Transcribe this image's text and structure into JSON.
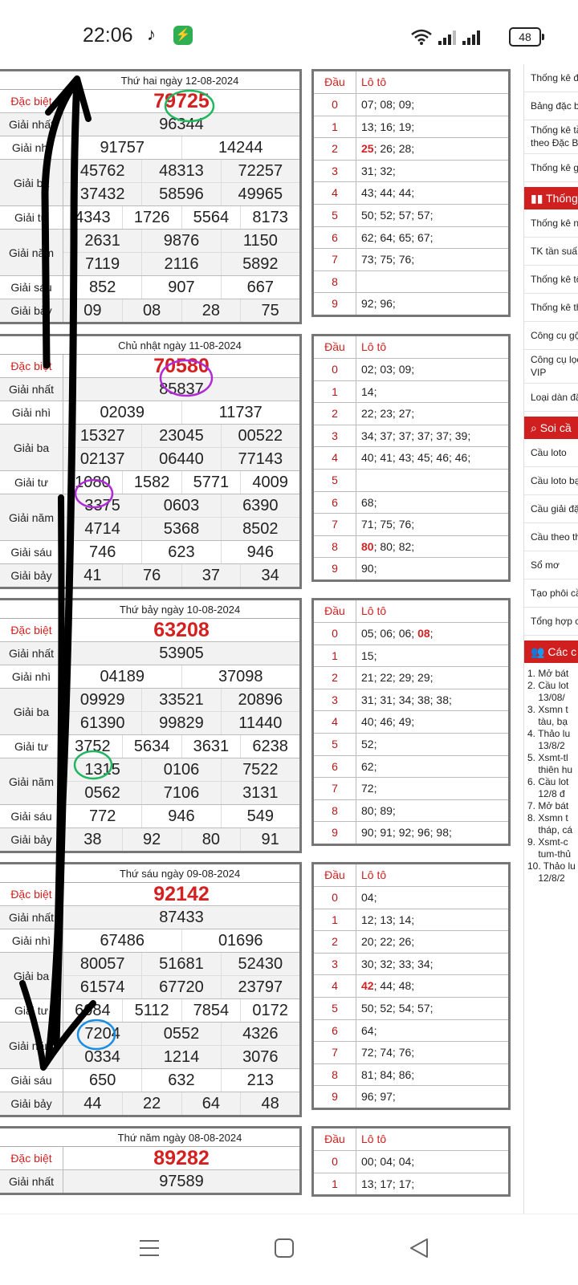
{
  "status_bar": {
    "time": "22:06",
    "battery": "48"
  },
  "draws": [
    {
      "header": "Thứ hai ngày 12-08-2024",
      "prizes": [
        {
          "label": "Đặc biệt",
          "rows": [
            [
              "79725"
            ]
          ],
          "special": true
        },
        {
          "label": "Giải nhất",
          "rows": [
            [
              "96344"
            ]
          ]
        },
        {
          "label": "Giải nhì",
          "rows": [
            [
              "91757",
              "14244"
            ]
          ]
        },
        {
          "label": "Giải ba",
          "rows": [
            [
              "45762",
              "48313",
              "72257"
            ],
            [
              "37432",
              "58596",
              "49965"
            ]
          ]
        },
        {
          "label": "Giải tư",
          "rows": [
            [
              "4343",
              "1726",
              "5564",
              "8173"
            ]
          ]
        },
        {
          "label": "Giải năm",
          "rows": [
            [
              "2631",
              "9876",
              "1150"
            ],
            [
              "7119",
              "2116",
              "5892"
            ]
          ]
        },
        {
          "label": "Giải sáu",
          "rows": [
            [
              "852",
              "907",
              "667"
            ]
          ]
        },
        {
          "label": "Giải bảy",
          "rows": [
            [
              "09",
              "08",
              "28",
              "75"
            ]
          ]
        }
      ],
      "loto": [
        {
          "dau": "0",
          "nums": [
            [
              "07; 08; 09;",
              false
            ]
          ]
        },
        {
          "dau": "1",
          "nums": [
            [
              "13; 16; 19;",
              false
            ]
          ]
        },
        {
          "dau": "2",
          "nums": [
            [
              "25",
              true
            ],
            [
              "; 26; 28;",
              false
            ]
          ]
        },
        {
          "dau": "3",
          "nums": [
            [
              "31; 32;",
              false
            ]
          ]
        },
        {
          "dau": "4",
          "nums": [
            [
              "43; 44; 44;",
              false
            ]
          ]
        },
        {
          "dau": "5",
          "nums": [
            [
              "50; 52; 57; 57;",
              false
            ]
          ]
        },
        {
          "dau": "6",
          "nums": [
            [
              "62; 64; 65; 67;",
              false
            ]
          ]
        },
        {
          "dau": "7",
          "nums": [
            [
              "73; 75; 76;",
              false
            ]
          ]
        },
        {
          "dau": "8",
          "nums": [
            [
              "",
              false
            ]
          ]
        },
        {
          "dau": "9",
          "nums": [
            [
              "92; 96;",
              false
            ]
          ]
        }
      ]
    },
    {
      "header": "Chủ nhật ngày 11-08-2024",
      "prizes": [
        {
          "label": "Đặc biệt",
          "rows": [
            [
              "70580"
            ]
          ],
          "special": true
        },
        {
          "label": "Giải nhất",
          "rows": [
            [
              "85837"
            ]
          ]
        },
        {
          "label": "Giải nhì",
          "rows": [
            [
              "02039",
              "11737"
            ]
          ]
        },
        {
          "label": "Giải ba",
          "rows": [
            [
              "15327",
              "23045",
              "00522"
            ],
            [
              "02137",
              "06440",
              "77143"
            ]
          ]
        },
        {
          "label": "Giải tư",
          "rows": [
            [
              "1080",
              "1582",
              "5771",
              "4009"
            ]
          ]
        },
        {
          "label": "Giải năm",
          "rows": [
            [
              "3375",
              "0603",
              "6390"
            ],
            [
              "4714",
              "5368",
              "8502"
            ]
          ]
        },
        {
          "label": "Giải sáu",
          "rows": [
            [
              "746",
              "623",
              "946"
            ]
          ]
        },
        {
          "label": "Giải bảy",
          "rows": [
            [
              "41",
              "76",
              "37",
              "34"
            ]
          ]
        }
      ],
      "loto": [
        {
          "dau": "0",
          "nums": [
            [
              "02; 03; 09;",
              false
            ]
          ]
        },
        {
          "dau": "1",
          "nums": [
            [
              "14;",
              false
            ]
          ]
        },
        {
          "dau": "2",
          "nums": [
            [
              "22; 23; 27;",
              false
            ]
          ]
        },
        {
          "dau": "3",
          "nums": [
            [
              "34; 37; 37; 37; 37; 39;",
              false
            ]
          ]
        },
        {
          "dau": "4",
          "nums": [
            [
              "40; 41; 43; 45; 46; 46;",
              false
            ]
          ]
        },
        {
          "dau": "5",
          "nums": [
            [
              "",
              false
            ]
          ]
        },
        {
          "dau": "6",
          "nums": [
            [
              "68;",
              false
            ]
          ]
        },
        {
          "dau": "7",
          "nums": [
            [
              "71; 75; 76;",
              false
            ]
          ]
        },
        {
          "dau": "8",
          "nums": [
            [
              "80",
              true
            ],
            [
              "; 80; 82;",
              false
            ]
          ]
        },
        {
          "dau": "9",
          "nums": [
            [
              "90;",
              false
            ]
          ]
        }
      ]
    },
    {
      "header": "Thứ bảy ngày 10-08-2024",
      "prizes": [
        {
          "label": "Đặc biệt",
          "rows": [
            [
              "63208"
            ]
          ],
          "special": true
        },
        {
          "label": "Giải nhất",
          "rows": [
            [
              "53905"
            ]
          ]
        },
        {
          "label": "Giải nhì",
          "rows": [
            [
              "04189",
              "37098"
            ]
          ]
        },
        {
          "label": "Giải ba",
          "rows": [
            [
              "09929",
              "33521",
              "20896"
            ],
            [
              "61390",
              "99829",
              "11440"
            ]
          ]
        },
        {
          "label": "Giải tư",
          "rows": [
            [
              "3752",
              "5634",
              "3631",
              "6238"
            ]
          ]
        },
        {
          "label": "Giải năm",
          "rows": [
            [
              "1315",
              "0106",
              "7522"
            ],
            [
              "0562",
              "7106",
              "3131"
            ]
          ]
        },
        {
          "label": "Giải sáu",
          "rows": [
            [
              "772",
              "946",
              "549"
            ]
          ]
        },
        {
          "label": "Giải bảy",
          "rows": [
            [
              "38",
              "92",
              "80",
              "91"
            ]
          ]
        }
      ],
      "loto": [
        {
          "dau": "0",
          "nums": [
            [
              "05; 06; 06; ",
              false
            ],
            [
              "08",
              true
            ],
            [
              ";",
              false
            ]
          ]
        },
        {
          "dau": "1",
          "nums": [
            [
              "15;",
              false
            ]
          ]
        },
        {
          "dau": "2",
          "nums": [
            [
              "21; 22; 29; 29;",
              false
            ]
          ]
        },
        {
          "dau": "3",
          "nums": [
            [
              "31; 31; 34; 38; 38;",
              false
            ]
          ]
        },
        {
          "dau": "4",
          "nums": [
            [
              "40; 46; 49;",
              false
            ]
          ]
        },
        {
          "dau": "5",
          "nums": [
            [
              "52;",
              false
            ]
          ]
        },
        {
          "dau": "6",
          "nums": [
            [
              "62;",
              false
            ]
          ]
        },
        {
          "dau": "7",
          "nums": [
            [
              "72;",
              false
            ]
          ]
        },
        {
          "dau": "8",
          "nums": [
            [
              "80; 89;",
              false
            ]
          ]
        },
        {
          "dau": "9",
          "nums": [
            [
              "90; 91; 92; 96; 98;",
              false
            ]
          ]
        }
      ]
    },
    {
      "header": "Thứ sáu ngày 09-08-2024",
      "prizes": [
        {
          "label": "Đặc biệt",
          "rows": [
            [
              "92142"
            ]
          ],
          "special": true
        },
        {
          "label": "Giải nhất",
          "rows": [
            [
              "87433"
            ]
          ]
        },
        {
          "label": "Giải nhì",
          "rows": [
            [
              "67486",
              "01696"
            ]
          ]
        },
        {
          "label": "Giải ba",
          "rows": [
            [
              "80057",
              "51681",
              "52430"
            ],
            [
              "61574",
              "67720",
              "23797"
            ]
          ]
        },
        {
          "label": "Giải tư",
          "rows": [
            [
              "6084",
              "5112",
              "7854",
              "0172"
            ]
          ]
        },
        {
          "label": "Giải năm",
          "rows": [
            [
              "7204",
              "0552",
              "4326"
            ],
            [
              "0334",
              "1214",
              "3076"
            ]
          ]
        },
        {
          "label": "Giải sáu",
          "rows": [
            [
              "650",
              "632",
              "213"
            ]
          ]
        },
        {
          "label": "Giải bảy",
          "rows": [
            [
              "44",
              "22",
              "64",
              "48"
            ]
          ]
        }
      ],
      "loto": [
        {
          "dau": "0",
          "nums": [
            [
              "04;",
              false
            ]
          ]
        },
        {
          "dau": "1",
          "nums": [
            [
              "12; 13; 14;",
              false
            ]
          ]
        },
        {
          "dau": "2",
          "nums": [
            [
              "20; 22; 26;",
              false
            ]
          ]
        },
        {
          "dau": "3",
          "nums": [
            [
              "30; 32; 33; 34;",
              false
            ]
          ]
        },
        {
          "dau": "4",
          "nums": [
            [
              "42",
              true
            ],
            [
              "; 44; 48;",
              false
            ]
          ]
        },
        {
          "dau": "5",
          "nums": [
            [
              "50; 52; 54; 57;",
              false
            ]
          ]
        },
        {
          "dau": "6",
          "nums": [
            [
              "64;",
              false
            ]
          ]
        },
        {
          "dau": "7",
          "nums": [
            [
              "72; 74; 76;",
              false
            ]
          ]
        },
        {
          "dau": "8",
          "nums": [
            [
              "81; 84; 86;",
              false
            ]
          ]
        },
        {
          "dau": "9",
          "nums": [
            [
              "96; 97;",
              false
            ]
          ]
        }
      ]
    },
    {
      "header": "Thứ năm ngày 08-08-2024",
      "prizes": [
        {
          "label": "Đặc biệt",
          "rows": [
            [
              "89282"
            ]
          ],
          "special": true
        },
        {
          "label": "Giải nhất",
          "rows": [
            [
              "97589"
            ]
          ]
        }
      ],
      "loto": [
        {
          "dau": "0",
          "nums": [
            [
              "00; 04; 04;",
              false
            ]
          ]
        },
        {
          "dau": "1",
          "nums": [
            [
              "13; 17; 17;",
              false
            ]
          ]
        }
      ]
    }
  ],
  "loto_header": {
    "dau": "Đầu",
    "loto": "Lô tô"
  },
  "sidebar": {
    "group1": [
      "Thống kê đ",
      "Bảng đặc b",
      "Thống kê tầ\ntheo Đặc B",
      "Thống kê g"
    ],
    "head2": "Thống",
    "group2": [
      "Thống kê n",
      "TK tần suấ",
      "Thống kê tổ",
      "Thống kê th",
      "Công cụ gộ",
      "Công cụ lọc\nVIP",
      "Loại dàn đặ"
    ],
    "head3": "Soi cầ",
    "group3": [
      "Cầu loto",
      "Cầu loto bạ",
      "Cầu giải đặ",
      "Cầu theo th",
      "Sổ mơ",
      "Tạo phôi cầ",
      "Tổng hợp c"
    ],
    "head4": "Các c",
    "list4": [
      "1. Mở bát",
      "2. Cầu lot",
      "    13/08/",
      "3. Xsmn t",
      "    tàu, bạ",
      "4. Thảo lu",
      "    13/8/2",
      "5. Xsmt-tl",
      "    thiên hu",
      "6. Cầu lot",
      "    12/8 đ",
      "7. Mở bát",
      "8. Xsmn t",
      "    tháp, cá",
      "9. Xsmt-c",
      "    tum-thủ",
      "10. Thảo lu",
      "    12/8/2"
    ]
  }
}
